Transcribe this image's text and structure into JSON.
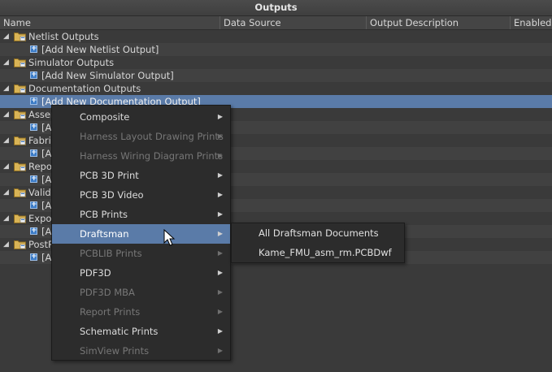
{
  "panel": {
    "title": "Outputs"
  },
  "columns": [
    "Name",
    "Data Source",
    "Output Description",
    "Enabled"
  ],
  "tree": [
    {
      "type": "group",
      "label": "Netlist Outputs"
    },
    {
      "type": "child",
      "label": "[Add New Netlist Output]"
    },
    {
      "type": "group",
      "label": "Simulator Outputs"
    },
    {
      "type": "child",
      "label": "[Add New Simulator Output]"
    },
    {
      "type": "group",
      "label": "Documentation Outputs"
    },
    {
      "type": "child",
      "label": "[Add New Documentation Output]",
      "selected": true
    },
    {
      "type": "group",
      "label": "Assem"
    },
    {
      "type": "child",
      "label": "[Ac"
    },
    {
      "type": "group",
      "label": "Fabric"
    },
    {
      "type": "child",
      "label": "[Ac"
    },
    {
      "type": "group",
      "label": "Repo"
    },
    {
      "type": "child",
      "label": "[Ac"
    },
    {
      "type": "group",
      "label": "Valida"
    },
    {
      "type": "child",
      "label": "[Ac"
    },
    {
      "type": "group",
      "label": "Expor"
    },
    {
      "type": "child",
      "label": "[Ac"
    },
    {
      "type": "group",
      "label": "PostP"
    },
    {
      "type": "child",
      "label": "[Ac"
    }
  ],
  "context_menu": {
    "items": [
      {
        "label": "Composite",
        "enabled": true
      },
      {
        "label": "Harness Layout Drawing Prints",
        "enabled": false
      },
      {
        "label": "Harness Wiring Diagram Prints",
        "enabled": false
      },
      {
        "label": "PCB 3D Print",
        "enabled": true
      },
      {
        "label": "PCB 3D Video",
        "enabled": true
      },
      {
        "label": "PCB Prints",
        "enabled": true
      },
      {
        "label": "Draftsman",
        "enabled": true,
        "highlighted": true
      },
      {
        "label": "PCBLIB Prints",
        "enabled": false
      },
      {
        "label": "PDF3D",
        "enabled": true
      },
      {
        "label": "PDF3D MBA",
        "enabled": false
      },
      {
        "label": "Report Prints",
        "enabled": false
      },
      {
        "label": "Schematic Prints",
        "enabled": true
      },
      {
        "label": "SimView Prints",
        "enabled": false
      }
    ]
  },
  "submenu": {
    "items": [
      {
        "label": "All Draftsman Documents"
      },
      {
        "label": "Kame_FMU_asm_rm.PCBDwf"
      }
    ]
  },
  "colors": {
    "selection": "#5a7ba8",
    "background": "#3a3a3a",
    "menu": "#2c2c2c"
  },
  "icons": {
    "group": "folder-icon",
    "child": "add-output-icon",
    "expand": "expand-caret-icon",
    "submenu": "submenu-arrow-icon",
    "cursor": "mouse-pointer-icon"
  }
}
